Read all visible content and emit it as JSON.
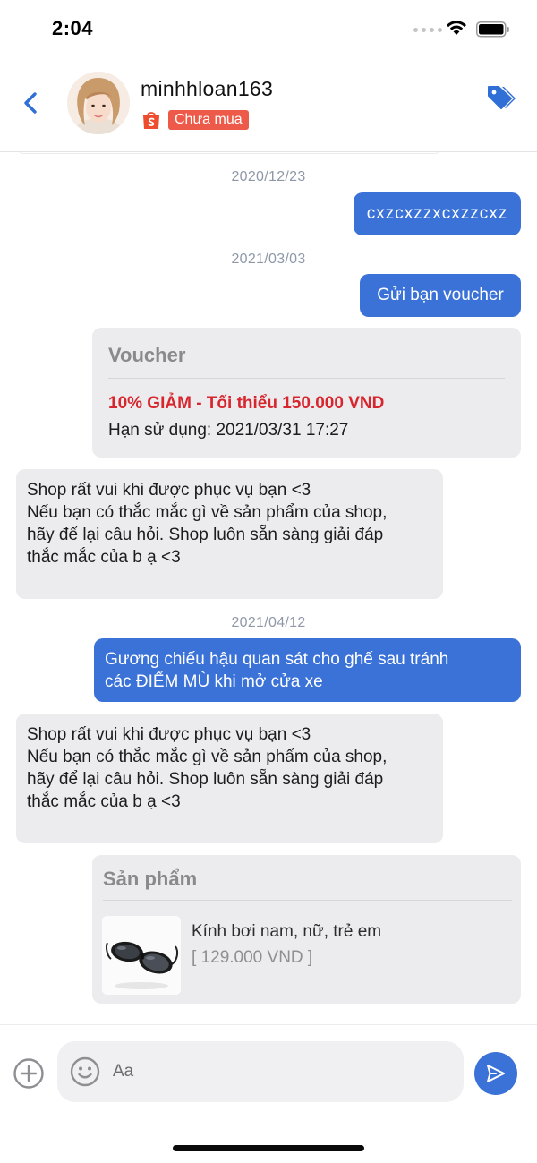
{
  "status_bar": {
    "time": "2:04"
  },
  "header": {
    "username": "minhhloan163",
    "status_badge": "Chưa mua"
  },
  "messages": [
    {
      "date": "2020/12/23"
    },
    {
      "outgoing": "cxzcxzzxcxzzcxz"
    },
    {
      "date": "2021/03/03"
    },
    {
      "outgoing": "Gửi bạn voucher"
    },
    {
      "voucher": {
        "title": "Voucher",
        "discount": "10% GIẢM - Tối thiểu 150.000 VND",
        "expiry": "Hạn sử dụng: 2021/03/31 17:27"
      }
    },
    {
      "incoming_lines": [
        "Shop rất vui khi được phục vụ bạn <3",
        "Nếu bạn có thắc mắc gì về sản phẩm của shop,",
        "hãy để lại câu hỏi. Shop luôn sẵn sàng giải đáp",
        "thắc mắc của b ạ <3"
      ]
    },
    {
      "date": "2021/04/12"
    },
    {
      "outgoing_lines": [
        "Gương chiếu hậu quan sát cho ghế sau tránh",
        "các ĐIỂM MÙ khi mở cửa xe"
      ]
    },
    {
      "incoming_lines": [
        "Shop rất vui khi được phục vụ bạn <3",
        "Nếu bạn có thắc mắc gì về sản phẩm của shop,",
        "hãy để lại câu hỏi. Shop luôn sẵn sàng giải đáp",
        "thắc mắc của b ạ <3"
      ]
    },
    {
      "product": {
        "title": "Sản phẩm",
        "name": "Kính bơi nam, nữ, trẻ em",
        "price": "[ 129.000 VND ]"
      }
    }
  ],
  "composer": {
    "placeholder": "Aa"
  },
  "icons": {
    "back": "chevron-left-icon",
    "tag": "tag-icon",
    "shop": "shopee-bag-icon",
    "plus": "plus-circle-icon",
    "emoji": "smiley-icon",
    "send": "send-icon"
  },
  "colors": {
    "accent": "#3a72d8",
    "badge": "#ee5a49",
    "discount": "#d8262e",
    "incoming_bubble": "#ececee"
  }
}
